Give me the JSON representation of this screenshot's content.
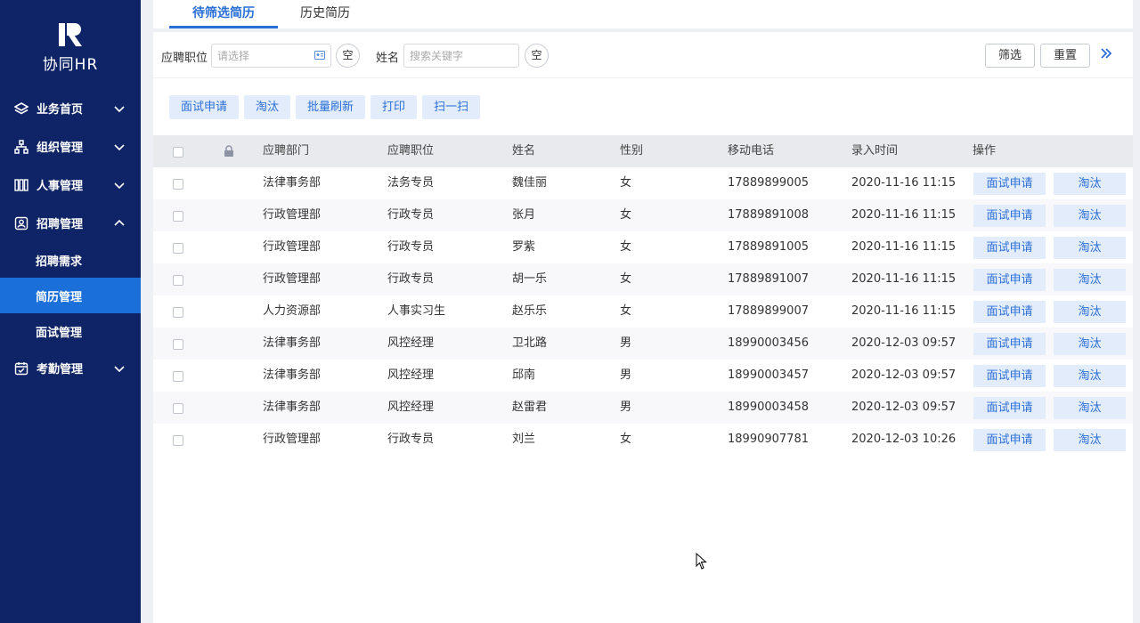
{
  "app": {
    "logo_text": "协同HR"
  },
  "sidebar": {
    "items": [
      {
        "label": "业务首页",
        "icon": "layers-icon",
        "expanded": false
      },
      {
        "label": "组织管理",
        "icon": "org-chart-icon",
        "expanded": false
      },
      {
        "label": "人事管理",
        "icon": "columns-icon",
        "expanded": false
      },
      {
        "label": "招聘管理",
        "icon": "recruit-icon",
        "expanded": true
      },
      {
        "label": "考勤管理",
        "icon": "calendar-check-icon",
        "expanded": false
      }
    ],
    "sub_items": [
      {
        "label": "招聘需求",
        "active": false
      },
      {
        "label": "简历管理",
        "active": true
      },
      {
        "label": "面试管理",
        "active": false
      }
    ]
  },
  "tabs": [
    {
      "label": "待筛选简历",
      "active": true
    },
    {
      "label": "历史简历",
      "active": false
    }
  ],
  "filter": {
    "position_label": "应聘职位",
    "position_placeholder": "请选择",
    "name_label": "姓名",
    "name_placeholder": "搜索关键字",
    "clear_label": "空",
    "filter_button": "筛选",
    "reset_button": "重置"
  },
  "actions": [
    "面试申请",
    "淘汰",
    "批量刷新",
    "打印",
    "扫一扫"
  ],
  "table": {
    "headers": [
      "应聘部门",
      "应聘职位",
      "姓名",
      "性别",
      "移动电话",
      "录入时间",
      "操作"
    ],
    "row_buttons": {
      "interview": "面试申请",
      "reject": "淘汰"
    },
    "rows": [
      {
        "dept": "法律事务部",
        "position": "法务专员",
        "name": "魏佳丽",
        "gender": "女",
        "phone": "17889899005",
        "time": "2020-11-16 11:15"
      },
      {
        "dept": "行政管理部",
        "position": "行政专员",
        "name": "张月",
        "gender": "女",
        "phone": "17889891008",
        "time": "2020-11-16 11:15"
      },
      {
        "dept": "行政管理部",
        "position": "行政专员",
        "name": "罗紫",
        "gender": "女",
        "phone": "17889891005",
        "time": "2020-11-16 11:15"
      },
      {
        "dept": "行政管理部",
        "position": "行政专员",
        "name": "胡一乐",
        "gender": "女",
        "phone": "17889891007",
        "time": "2020-11-16 11:15"
      },
      {
        "dept": "人力资源部",
        "position": "人事实习生",
        "name": "赵乐乐",
        "gender": "女",
        "phone": "17889899007",
        "time": "2020-11-16 11:15"
      },
      {
        "dept": "法律事务部",
        "position": "风控经理",
        "name": "卫北路",
        "gender": "男",
        "phone": "18990003456",
        "time": "2020-12-03 09:57"
      },
      {
        "dept": "法律事务部",
        "position": "风控经理",
        "name": "邱南",
        "gender": "男",
        "phone": "18990003457",
        "time": "2020-12-03 09:57"
      },
      {
        "dept": "法律事务部",
        "position": "风控经理",
        "name": "赵雷君",
        "gender": "男",
        "phone": "18990003458",
        "time": "2020-12-03 09:57"
      },
      {
        "dept": "行政管理部",
        "position": "行政专员",
        "name": "刘兰",
        "gender": "女",
        "phone": "18990907781",
        "time": "2020-12-03 10:26"
      }
    ]
  },
  "colors": {
    "sidebar_bg": "#0f2466",
    "accent": "#2a6fd6",
    "active_item": "#1b6fd8",
    "button_bg": "#e3ecfb"
  }
}
